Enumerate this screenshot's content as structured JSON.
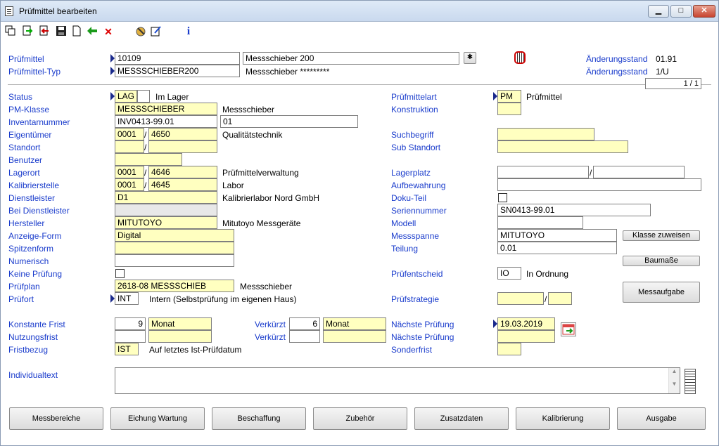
{
  "window": {
    "title": "Prüfmittel bearbeiten",
    "minimize": "▁",
    "maximize": "□",
    "close": "✕"
  },
  "header": {
    "pruefmittel_label": "Prüfmittel",
    "pruefmittel_value": "10109",
    "pruefmittel_desc": "Messschieber 200",
    "typ_label": "Prüfmittel-Typ",
    "typ_value": "MESSSCHIEBER200",
    "typ_desc": "Messschieber *********",
    "aenderung1_label": "Änderungsstand",
    "aenderung1_value": "01.91",
    "aenderung2_label": "Änderungsstand",
    "aenderung2_value": "1/U",
    "page_counter": "1 / 1"
  },
  "left": {
    "status": {
      "label": "Status",
      "code": "LAG",
      "text": "Im Lager"
    },
    "pmklasse": {
      "label": "PM-Klasse",
      "value": "MESSSCHIEBER",
      "text": "Messschieber"
    },
    "inventar": {
      "label": "Inventarnummer",
      "value": "INV0413-99.01",
      "value2": "01"
    },
    "eigentuemer": {
      "label": "Eigentümer",
      "v1": "0001",
      "v2": "4650",
      "text": "Qualitätstechnik"
    },
    "standort": {
      "label": "Standort"
    },
    "benutzer": {
      "label": "Benutzer"
    },
    "lagerort": {
      "label": "Lagerort",
      "v1": "0001",
      "v2": "4646",
      "text": "Prüfmittelverwaltung"
    },
    "kalibrierstelle": {
      "label": "Kalibrierstelle",
      "v1": "0001",
      "v2": "4645",
      "text": "Labor"
    },
    "dienstleister": {
      "label": "Dienstleister",
      "value": "D1",
      "text": "Kalibrierlabor Nord GmbH"
    },
    "bei_dienstleister": {
      "label": "Bei Dienstleister"
    },
    "hersteller": {
      "label": "Hersteller",
      "value": "MITUTOYO",
      "text": "Mitutoyo Messgeräte"
    },
    "anzeige": {
      "label": "Anzeige-Form",
      "value": "Digital"
    },
    "spitzenform": {
      "label": "Spitzenform"
    },
    "numerisch": {
      "label": "Numerisch"
    },
    "keine_pruefung": {
      "label": "Keine Prüfung"
    },
    "pruefplan": {
      "label": "Prüfplan",
      "value": "2618-08 MESSSCHIEB",
      "text": "Messschieber"
    },
    "pruefort": {
      "label": "Prüfort",
      "value": "INT",
      "text": "Intern (Selbstprüfung im eigenen Haus)"
    }
  },
  "right": {
    "pruefmittelart": {
      "label": "Prüfmittelart",
      "value": "PM",
      "text": "Prüfmittel"
    },
    "konstruktion": {
      "label": "Konstruktion"
    },
    "suchbegriff": {
      "label": "Suchbegriff"
    },
    "substandort": {
      "label": "Sub Standort"
    },
    "lagerplatz": {
      "label": "Lagerplatz"
    },
    "aufbewahrung": {
      "label": "Aufbewahrung"
    },
    "dokuteil": {
      "label": "Doku-Teil"
    },
    "seriennummer": {
      "label": "Seriennummer",
      "value": "SN0413-99.01"
    },
    "modell": {
      "label": "Modell"
    },
    "messspanne": {
      "label": "Messspanne",
      "value": "MITUTOYO"
    },
    "teilung": {
      "label": "Teilung",
      "value": "0.01"
    },
    "pruefentscheid": {
      "label": "Prüfentscheid",
      "value": "IO",
      "text": "In Ordnung"
    },
    "pruefstrategie": {
      "label": "Prüfstrategie"
    },
    "klasse_btn": "Klasse zuweisen",
    "baumasse_btn": "Baumaße",
    "messaufgabe_btn": "Messaufgabe"
  },
  "fristen": {
    "konstante": {
      "label": "Konstante Frist",
      "value": "9",
      "unit": "Monat"
    },
    "nutzung": {
      "label": "Nutzungsfrist"
    },
    "fristbezug": {
      "label": "Fristbezug",
      "value": "IST",
      "text": "Auf letztes Ist-Prüfdatum"
    },
    "verkuerzt1": {
      "label": "Verkürzt",
      "value": "6",
      "unit": "Monat"
    },
    "verkuerzt2": {
      "label": "Verkürzt"
    },
    "naechste1": {
      "label": "Nächste Prüfung",
      "value": "19.03.2019"
    },
    "naechste2": {
      "label": "Nächste Prüfung"
    },
    "sonderfrist": {
      "label": "Sonderfrist"
    }
  },
  "individualtext": {
    "label": "Individualtext"
  },
  "buttons": [
    "Messbereiche",
    "Eichung Wartung",
    "Beschaffung",
    "Zubehör",
    "Zusatzdaten",
    "Kalibrierung",
    "Ausgabe"
  ],
  "icons": [
    "copy-icon",
    "export-icon",
    "import-icon",
    "save-icon",
    "new-document-icon",
    "back-arrow-icon",
    "delete-icon",
    "tools-icon",
    "edit-icon",
    "info-icon"
  ],
  "colors": {
    "label": "#1a3ccc",
    "field_yellow": "#ffffc0"
  }
}
